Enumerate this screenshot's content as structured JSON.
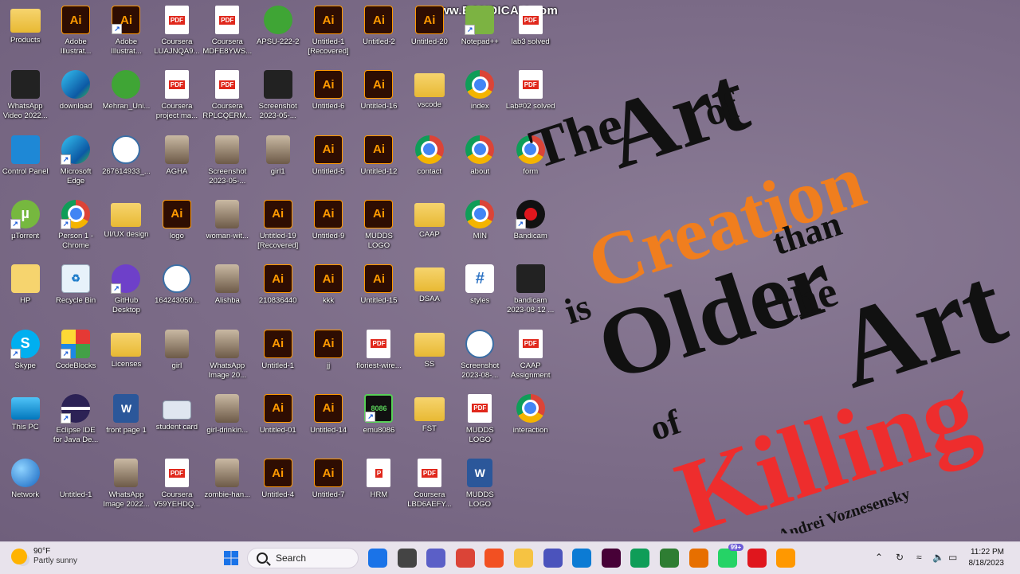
{
  "watermark": "www.BANDICAM.com",
  "desktop_icons": [
    {
      "label": "Products",
      "type": "folder",
      "glyph": ""
    },
    {
      "label": "Adobe Illustrat...",
      "type": "ai",
      "glyph": "Ai"
    },
    {
      "label": "Adobe Illustrat...",
      "type": "ai",
      "glyph": "Ai",
      "shortcut": true
    },
    {
      "label": "Coursera LUAJNQA9...",
      "type": "pdf",
      "glyph": "PDF"
    },
    {
      "label": "Coursera MDFE8YWS...",
      "type": "pdf",
      "glyph": "PDF"
    },
    {
      "label": "APSU-222-2",
      "type": "green",
      "glyph": ""
    },
    {
      "label": "Untitled-1 [Recovered]",
      "type": "ai",
      "glyph": "Ai"
    },
    {
      "label": "Untitled-2",
      "type": "ai",
      "glyph": "Ai"
    },
    {
      "label": "Untitled-20",
      "type": "ai",
      "glyph": "Ai"
    },
    {
      "label": "Notepad++",
      "type": "notepad",
      "glyph": "",
      "shortcut": true
    },
    {
      "label": "lab3 solved",
      "type": "pdf",
      "glyph": "PDF"
    },
    {
      "label": "WhatsApp Video 2022...",
      "type": "dark",
      "glyph": ""
    },
    {
      "label": "download",
      "type": "edge",
      "glyph": ""
    },
    {
      "label": "Mehran_Uni...",
      "type": "green",
      "glyph": ""
    },
    {
      "label": "Coursera project ma...",
      "type": "pdf",
      "glyph": "PDF"
    },
    {
      "label": "Coursera RPLCQERM...",
      "type": "pdf",
      "glyph": "PDF"
    },
    {
      "label": "Screenshot 2023-05-...",
      "type": "dark",
      "glyph": ""
    },
    {
      "label": "Untitled-6",
      "type": "ai",
      "glyph": "Ai"
    },
    {
      "label": "Untitled-16",
      "type": "ai",
      "glyph": "Ai"
    },
    {
      "label": "vscode",
      "type": "folder",
      "glyph": ""
    },
    {
      "label": "index",
      "type": "chrome",
      "glyph": ""
    },
    {
      "label": "Lab#02 solved",
      "type": "pdf",
      "glyph": "PDF"
    },
    {
      "label": "Control Panel",
      "type": "bluebox",
      "glyph": ""
    },
    {
      "label": "Microsoft Edge",
      "type": "edge",
      "glyph": "",
      "shortcut": true
    },
    {
      "label": "267614933_...",
      "type": "seal",
      "glyph": ""
    },
    {
      "label": "AGHA",
      "type": "photo",
      "glyph": ""
    },
    {
      "label": "Screenshot 2023-05-...",
      "type": "photo",
      "glyph": ""
    },
    {
      "label": "girl1",
      "type": "photo",
      "glyph": ""
    },
    {
      "label": "Untitled-5",
      "type": "ai",
      "glyph": "Ai"
    },
    {
      "label": "Untitled-12",
      "type": "ai",
      "glyph": "Ai"
    },
    {
      "label": "contact",
      "type": "chrome",
      "glyph": ""
    },
    {
      "label": "about",
      "type": "chrome",
      "glyph": ""
    },
    {
      "label": "form",
      "type": "chrome",
      "glyph": ""
    },
    {
      "label": "µTorrent",
      "type": "utorrent",
      "glyph": "µ",
      "shortcut": true
    },
    {
      "label": "Person 1 - Chrome",
      "type": "chrome",
      "glyph": "",
      "shortcut": true
    },
    {
      "label": "UI/UX design",
      "type": "folder",
      "glyph": ""
    },
    {
      "label": "logo",
      "type": "ai",
      "glyph": "Ai"
    },
    {
      "label": "woman-wit...",
      "type": "photo",
      "glyph": ""
    },
    {
      "label": "Untitled-19 [Recovered]",
      "type": "ai",
      "glyph": "Ai"
    },
    {
      "label": "Untitled-9",
      "type": "ai",
      "glyph": "Ai"
    },
    {
      "label": "MUDDS LOGO",
      "type": "ai",
      "glyph": "Ai"
    },
    {
      "label": "CAAP",
      "type": "folder",
      "glyph": ""
    },
    {
      "label": "MIN",
      "type": "chrome",
      "glyph": ""
    },
    {
      "label": "Bandicam",
      "type": "rec",
      "glyph": "",
      "shortcut": true
    },
    {
      "label": "HP",
      "type": "hp",
      "glyph": ""
    },
    {
      "label": "Recycle Bin",
      "type": "recycle",
      "glyph": "♻"
    },
    {
      "label": "GitHub Desktop",
      "type": "github",
      "glyph": "",
      "shortcut": true
    },
    {
      "label": "164243050...",
      "type": "seal",
      "glyph": ""
    },
    {
      "label": "Alishba",
      "type": "photo",
      "glyph": ""
    },
    {
      "label": "210836440",
      "type": "ai",
      "glyph": "Ai"
    },
    {
      "label": "kkk",
      "type": "ai",
      "glyph": "Ai"
    },
    {
      "label": "Untitled-15",
      "type": "ai",
      "glyph": "Ai"
    },
    {
      "label": "DSAA",
      "type": "folder",
      "glyph": ""
    },
    {
      "label": "styles",
      "type": "hash",
      "glyph": "#"
    },
    {
      "label": "bandicam 2023-08-12 ...",
      "type": "dark",
      "glyph": ""
    },
    {
      "label": "Skype",
      "type": "sky",
      "glyph": "S",
      "shortcut": true
    },
    {
      "label": "CodeBlocks",
      "type": "codeblocks",
      "glyph": "",
      "shortcut": true
    },
    {
      "label": "Licenses",
      "type": "folder",
      "glyph": ""
    },
    {
      "label": "girl",
      "type": "photo",
      "glyph": ""
    },
    {
      "label": "WhatsApp Image 20...",
      "type": "photo",
      "glyph": ""
    },
    {
      "label": "Untitled-1",
      "type": "ai",
      "glyph": "Ai"
    },
    {
      "label": "jj",
      "type": "ai",
      "glyph": "Ai"
    },
    {
      "label": "floriest-wire...",
      "type": "pdf",
      "glyph": "PDF"
    },
    {
      "label": "SS",
      "type": "folder",
      "glyph": ""
    },
    {
      "label": "Screenshot 2023-08-...",
      "type": "seal",
      "glyph": ""
    },
    {
      "label": "CAAP Assignment",
      "type": "pdf",
      "glyph": "PDF"
    },
    {
      "label": "This PC",
      "type": "monitor",
      "glyph": ""
    },
    {
      "label": "Eclipse IDE for Java De...",
      "type": "eclipse",
      "glyph": "",
      "shortcut": true
    },
    {
      "label": "front page 1",
      "type": "word",
      "glyph": "W"
    },
    {
      "label": "student card",
      "type": "card",
      "glyph": ""
    },
    {
      "label": "girl-drinkin...",
      "type": "photo",
      "glyph": ""
    },
    {
      "label": "Untitled-01",
      "type": "ai",
      "glyph": "Ai"
    },
    {
      "label": "Untitled-14",
      "type": "ai",
      "glyph": "Ai"
    },
    {
      "label": "emu8086",
      "type": "chip",
      "glyph": "8086",
      "shortcut": true
    },
    {
      "label": "FST",
      "type": "folder",
      "glyph": ""
    },
    {
      "label": "MUDDS LOGO",
      "type": "pdf",
      "glyph": "PDF"
    },
    {
      "label": "interaction",
      "type": "chrome",
      "glyph": ""
    },
    {
      "label": "Network",
      "type": "globe",
      "glyph": ""
    },
    {
      "label": "Untitled-1",
      "type": "blank",
      "glyph": ""
    },
    {
      "label": "WhatsApp Image 2022...",
      "type": "photo",
      "glyph": ""
    },
    {
      "label": "Coursera V59YEHDQ...",
      "type": "pdf",
      "glyph": "PDF"
    },
    {
      "label": "zombie-han...",
      "type": "photo",
      "glyph": ""
    },
    {
      "label": "Untitled-4",
      "type": "ai",
      "glyph": "Ai"
    },
    {
      "label": "Untitled-7",
      "type": "ai",
      "glyph": "Ai"
    },
    {
      "label": "HRM",
      "type": "pdf",
      "glyph": "P"
    },
    {
      "label": "Coursera LBD6AEFY...",
      "type": "pdf",
      "glyph": "PDF"
    },
    {
      "label": "MUDDS LOGO DESC...",
      "type": "word",
      "glyph": "W"
    }
  ],
  "wallpaper_quote": {
    "the": "The",
    "art1": "Art",
    "of1": "of",
    "creation": "Creation",
    "is": "is",
    "older": "Older",
    "than": "than",
    "the2": "the",
    "art2": "Art",
    "of2": "of",
    "killing": "Killing",
    "author": "- Andrei Voznesensky",
    "colors": {
      "black": "#111111",
      "orange": "#f07e1e",
      "red": "#ee2d2d"
    }
  },
  "taskbar": {
    "weather_temp": "90°F",
    "weather_desc": "Partly sunny",
    "search_label": "Search",
    "time": "11:22 PM",
    "date": "8/18/2023",
    "whatsapp_badge": "99+",
    "apps": [
      {
        "name": "start-icon",
        "color": "#1a73e8"
      },
      {
        "name": "task-view-icon",
        "color": "#444"
      },
      {
        "name": "teams-chat-icon",
        "color": "#5b5fc7"
      },
      {
        "name": "chrome-icon",
        "color": "#db4437"
      },
      {
        "name": "microsoft-store-icon",
        "color": "#f25022"
      },
      {
        "name": "file-explorer-icon",
        "color": "#f6c342"
      },
      {
        "name": "teams-icon",
        "color": "#4b53bc"
      },
      {
        "name": "edge-icon",
        "color": "#0c7bd4"
      },
      {
        "name": "adobe-xd-icon",
        "color": "#470137"
      },
      {
        "name": "chrome-profile-icon",
        "color": "#0f9d58"
      },
      {
        "name": "emu8086-icon",
        "color": "#2e7d32"
      },
      {
        "name": "java-icon",
        "color": "#e76f00"
      },
      {
        "name": "whatsapp-icon",
        "color": "#25d366"
      },
      {
        "name": "bandicam-record-icon",
        "color": "#e0161d"
      },
      {
        "name": "sublime-icon",
        "color": "#ff9800"
      }
    ]
  }
}
